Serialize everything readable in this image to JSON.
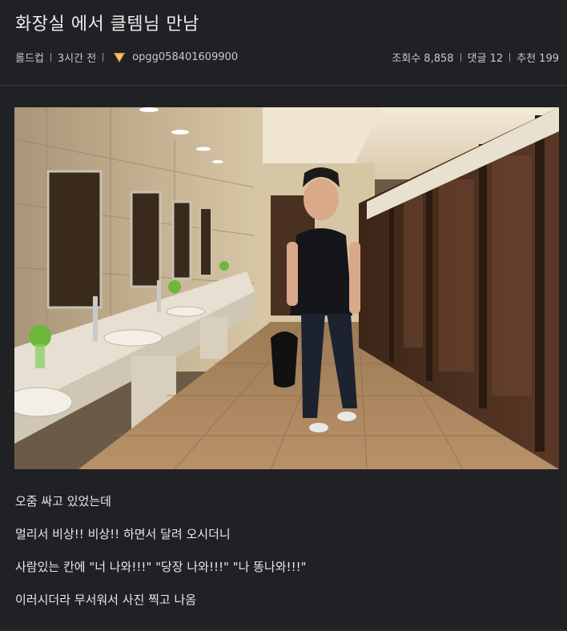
{
  "post": {
    "title": "화장실 에서 클템님 만남",
    "category": "롤드컵",
    "time": "3시간 전",
    "author": "opgg058401609900",
    "views": "조회수 8,858",
    "comments": "댓글 12",
    "recommends": "추천 199"
  },
  "content": {
    "lines": [
      "오줌 싸고 있었는데",
      "멀리서 비상!! 비상!! 하면서 달려 오시더니",
      "사람있는 칸에 \"너 나와!!!\" \"당장 나와!!!\" \"나 똥나와!!!\"",
      "이러시더라 무서워서 사진 찍고 나옴"
    ]
  },
  "colors": {
    "background": "#202125",
    "tier_icon": "#e8a23c"
  },
  "icons": {
    "tier": "tier-badge-icon"
  }
}
